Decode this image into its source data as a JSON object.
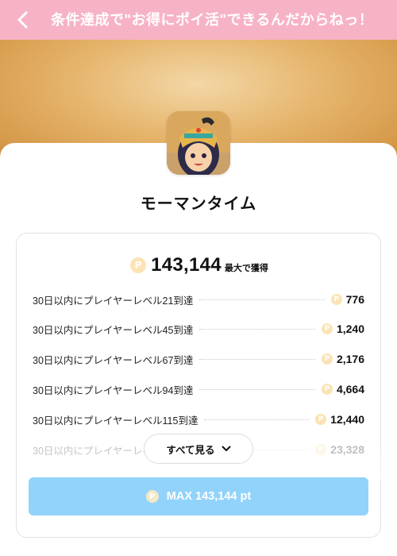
{
  "header": {
    "title": "条件達成で\"お得にポイ活\"できるんだからねっ！"
  },
  "app": {
    "name": "モーマンタイム"
  },
  "reward": {
    "total": "143,144",
    "suffix": "最大で獲得"
  },
  "coin_symbol": "P",
  "missions": [
    {
      "label": "30日以内にプレイヤーレベル21到達",
      "points": "776"
    },
    {
      "label": "30日以内にプレイヤーレベル45到達",
      "points": "1,240"
    },
    {
      "label": "30日以内にプレイヤーレベル67到達",
      "points": "2,176"
    },
    {
      "label": "30日以内にプレイヤーレベル94到達",
      "points": "4,664"
    },
    {
      "label": "30日以内にプレイヤーレベル115到達",
      "points": "12,440"
    },
    {
      "label": "30日以内にプレイヤーレベル",
      "points": "23,328"
    }
  ],
  "see_all": {
    "label": "すべて見る"
  },
  "cta": {
    "label": "MAX 143,144 pt"
  },
  "colors": {
    "header_bg": "#f7b3c6",
    "cta_bg": "#92d3fb",
    "coin": "#fbe3b5"
  },
  "icons": {
    "back": "chevron-left-icon",
    "expand": "chevron-down-icon",
    "coin": "coin-icon"
  }
}
